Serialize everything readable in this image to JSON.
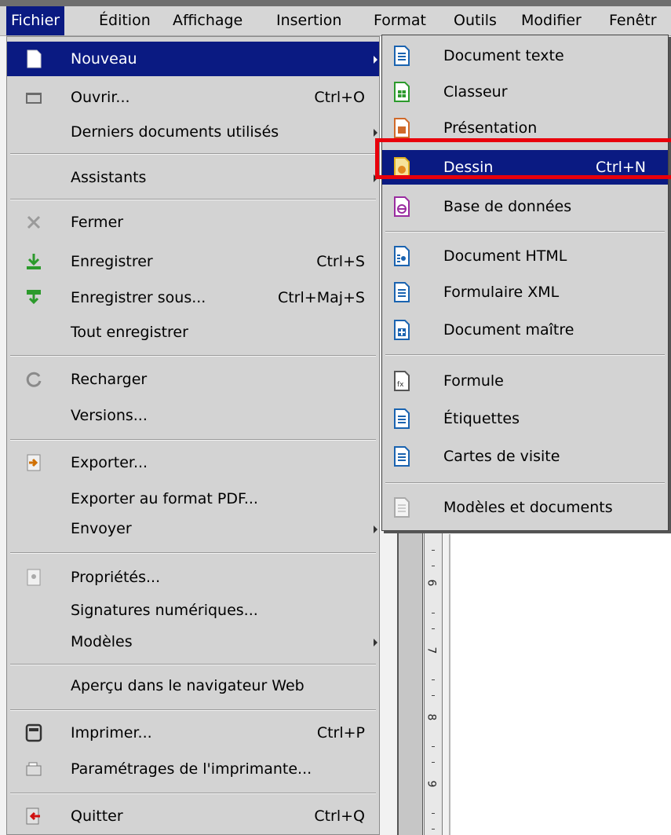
{
  "menubar": {
    "items": [
      "Fichier",
      "Édition",
      "Affichage",
      "Insertion",
      "Format",
      "Outils",
      "Modifier",
      "Fenêtr"
    ]
  },
  "file_menu": {
    "nouveau": "Nouveau",
    "ouvrir": "Ouvrir...",
    "ouvrir_sc": "Ctrl+O",
    "derniers": "Derniers documents utilisés",
    "assistants": "Assistants",
    "fermer": "Fermer",
    "enregistrer": "Enregistrer",
    "enregistrer_sc": "Ctrl+S",
    "enregistrer_sous": "Enregistrer sous...",
    "enregistrer_sous_sc": "Ctrl+Maj+S",
    "tout_enregistrer": "Tout enregistrer",
    "recharger": "Recharger",
    "versions": "Versions...",
    "exporter": "Exporter...",
    "exporter_pdf": "Exporter au format PDF...",
    "envoyer": "Envoyer",
    "proprietes": "Propriétés...",
    "signatures": "Signatures numériques...",
    "modeles": "Modèles",
    "apercu": "Aperçu dans le navigateur Web",
    "imprimer": "Imprimer...",
    "imprimer_sc": "Ctrl+P",
    "parametrages": "Paramétrages de l'imprimante...",
    "quitter": "Quitter",
    "quitter_sc": "Ctrl+Q"
  },
  "new_menu": {
    "texte": "Document texte",
    "classeur": "Classeur",
    "presentation": "Présentation",
    "dessin": "Dessin",
    "dessin_sc": "Ctrl+N",
    "base": "Base de données",
    "html": "Document HTML",
    "xml": "Formulaire XML",
    "maitre": "Document maître",
    "formule": "Formule",
    "etiquettes": "Étiquettes",
    "cartes": "Cartes de visite",
    "modeles": "Modèles et documents"
  },
  "ruler": {
    "numbers": [
      "6",
      "7",
      "8",
      "9"
    ]
  },
  "colors": {
    "highlight": "#0a1a82",
    "callout": "#e8000b"
  }
}
